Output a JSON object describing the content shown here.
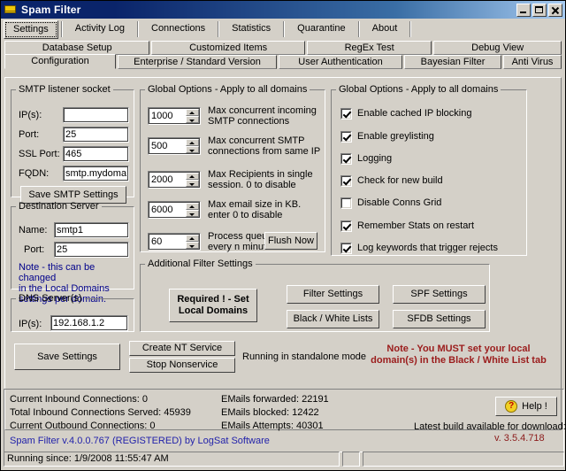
{
  "window": {
    "title": "Spam Filter",
    "icon": "envelope-icon",
    "controls": {
      "minimize": "minimize-icon",
      "maximize": "maximize-icon",
      "close": "close-icon"
    }
  },
  "top_tabs": [
    {
      "label": "Settings",
      "selected": true
    },
    {
      "label": "Activity Log",
      "selected": false
    },
    {
      "label": "Connections",
      "selected": false
    },
    {
      "label": "Statistics",
      "selected": false
    },
    {
      "label": "Quarantine",
      "selected": false
    },
    {
      "label": "About",
      "selected": false
    }
  ],
  "sub_tabs_row1": [
    {
      "label": "Database Setup",
      "active": false
    },
    {
      "label": "Customized Items",
      "active": false
    },
    {
      "label": "RegEx Test",
      "active": false
    },
    {
      "label": "Debug View",
      "active": false
    }
  ],
  "sub_tabs_row2": [
    {
      "label": "Configuration",
      "active": true
    },
    {
      "label": "Enterprise / Standard Version",
      "active": false
    },
    {
      "label": "User Authentication",
      "active": false
    },
    {
      "label": "Bayesian Filter",
      "active": false
    },
    {
      "label": "Anti Virus",
      "active": false
    }
  ],
  "smtp_listener": {
    "legend": "SMTP listener socket",
    "ips_label": "IP(s):",
    "ips_value": "",
    "port_label": "Port:",
    "port_value": "25",
    "ssl_port_label": "SSL Port:",
    "ssl_port_value": "465",
    "fqdn_label": "FQDN:",
    "fqdn_value": "smtp.mydomain.",
    "save_button": "Save SMTP Settings"
  },
  "destination_server": {
    "legend": "Destination Server",
    "name_label": "Name:",
    "name_value": "smtp1",
    "port_label": "Port:",
    "port_value": "25",
    "note_line1": "Note - this can be changed",
    "note_line2": "in the Local Domains",
    "note_line3": "settings per domain."
  },
  "dns_servers": {
    "legend": "DNS Server(s)",
    "ips_label": "IP(s):",
    "ips_value": "192.168.1.2"
  },
  "global_options_numeric": {
    "legend": "Global Options - Apply to all domains",
    "items": [
      {
        "value": "1000",
        "desc_line1": "Max concurrent incoming",
        "desc_line2": "SMTP connections"
      },
      {
        "value": "500",
        "desc_line1": "Max concurrent SMTP",
        "desc_line2": "connections from same IP"
      },
      {
        "value": "2000",
        "desc_line1": "Max Recipients in single",
        "desc_line2": "session. 0 to disable"
      },
      {
        "value": "6000",
        "desc_line1": "Max email size in KB.",
        "desc_line2": "enter 0 to disable"
      },
      {
        "value": "60",
        "desc_line1": "Process queue",
        "desc_line2": "every n minutes"
      }
    ],
    "flush_button": "Flush Now"
  },
  "global_options_checks": {
    "legend": "Global Options - Apply to all domains",
    "items": [
      {
        "label": "Enable cached IP blocking",
        "checked": true
      },
      {
        "label": "Enable greylisting",
        "checked": true
      },
      {
        "label": "Logging",
        "checked": true
      },
      {
        "label": "Check for new build",
        "checked": true
      },
      {
        "label": "Disable Conns Grid",
        "checked": false
      },
      {
        "label": "Remember Stats on restart",
        "checked": true
      },
      {
        "label": "Log keywords that trigger rejects",
        "checked": true
      }
    ]
  },
  "additional_filter_settings": {
    "legend": "Additional Filter Settings",
    "required_button_line1": "Required ! - Set",
    "required_button_line2": "Local Domains",
    "filter_settings": "Filter Settings",
    "spf_settings": "SPF Settings",
    "black_white_lists": "Black / White Lists",
    "sfdb_settings": "SFDB Settings"
  },
  "actions": {
    "save_settings": "Save Settings",
    "create_nt_service": "Create NT Service",
    "stop_nonservice": "Stop Nonservice",
    "running_mode": "Running in standalone mode",
    "warning_line1": "Note - You MUST set your local",
    "warning_line2": "domain(s) in the Black / White List tab"
  },
  "status": {
    "current_inbound": "Current Inbound Connections: 0",
    "total_inbound": "Total Inbound Connections Served: 45939",
    "current_outbound": "Current Outbound Connections: 0",
    "emails_forwarded": "EMails forwarded: 22191",
    "emails_blocked": "EMails blocked: 12422",
    "emails_attempts": "EMails Attempts: 40301",
    "help_button": "Help !",
    "help_icon": "question-mark-icon",
    "latest_build_label": "Latest build available for download:",
    "latest_build_value": "v. 3.5.4.718",
    "product_line": "Spam Filter v.4.0.0.767 (REGISTERED) by LogSat Software",
    "running_since": "Running since: 1/9/2008 11:55:47 AM",
    "progress_value": ""
  },
  "colors": {
    "face": "#d4d0c8",
    "titlebar_start": "#0a246a",
    "titlebar_end": "#a6caf0",
    "note_blue": "#00008b",
    "warning_red": "#9b1c1c",
    "brand_blue": "#2222aa"
  }
}
